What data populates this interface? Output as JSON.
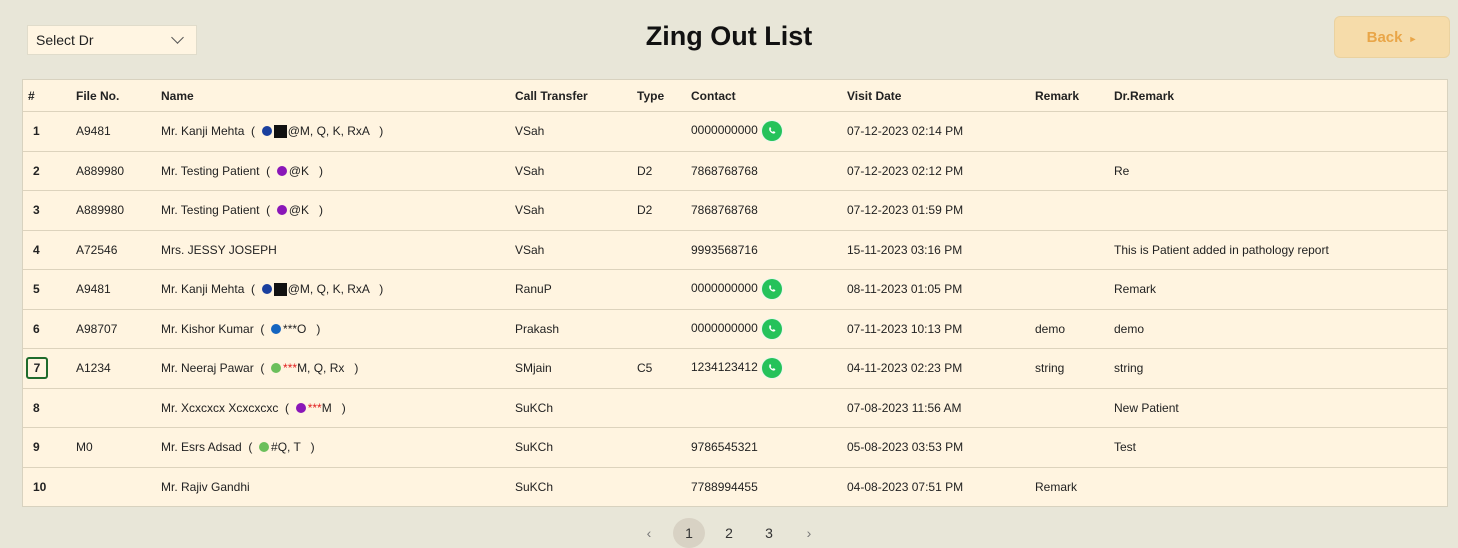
{
  "doctor_select": {
    "value": "Select Dr"
  },
  "title": "Zing Out List",
  "back": {
    "label": "Back",
    "arrow": "►"
  },
  "columns": [
    "#",
    "File No.",
    "Name",
    "Call Transfer",
    "Type",
    "Contact",
    "Visit Date",
    "Remark",
    "Dr.Remark"
  ],
  "rows": [
    {
      "num": "1",
      "file": "A9481",
      "name": "Mr. Kanji Mehta",
      "tag_prefix": "",
      "tag": "@M, Q, K, RxA",
      "dot_color": "#1a3f9e",
      "square": true,
      "transfer": "VSah",
      "type": "",
      "contact": "0000000000",
      "whatsapp": true,
      "date": "07-12-2023 02:14 PM",
      "remark": "",
      "dr_remark": ""
    },
    {
      "num": "2",
      "file": "A889980",
      "name": "Mr. Testing Patient",
      "tag_prefix": "",
      "tag": "@K",
      "dot_color": "#8a16b8",
      "square": false,
      "transfer": "VSah",
      "type": "D2",
      "contact": "7868768768",
      "whatsapp": false,
      "date": "07-12-2023 02:12 PM",
      "remark": "",
      "dr_remark": "Re"
    },
    {
      "num": "3",
      "file": "A889980",
      "name": "Mr. Testing Patient",
      "tag_prefix": "",
      "tag": "@K",
      "dot_color": "#8a16b8",
      "square": false,
      "transfer": "VSah",
      "type": "D2",
      "contact": "7868768768",
      "whatsapp": false,
      "date": "07-12-2023 01:59 PM",
      "remark": "",
      "dr_remark": ""
    },
    {
      "num": "4",
      "file": "A72546",
      "name": "Mrs. JESSY JOSEPH",
      "tag_prefix": "",
      "tag": "",
      "dot_color": "",
      "square": false,
      "transfer": "VSah",
      "type": "",
      "contact": "9993568716",
      "whatsapp": false,
      "date": "15-11-2023 03:16 PM",
      "remark": "",
      "dr_remark": "This is Patient added in pathology report"
    },
    {
      "num": "5",
      "file": "A9481",
      "name": "Mr. Kanji Mehta",
      "tag_prefix": "",
      "tag": "@M, Q, K, RxA",
      "dot_color": "#1a3f9e",
      "square": true,
      "transfer": "RanuP",
      "type": "",
      "contact": "0000000000",
      "whatsapp": true,
      "date": "08-11-2023 01:05 PM",
      "remark": "",
      "dr_remark": "Remark"
    },
    {
      "num": "6",
      "file": "A98707",
      "name": "Mr. Kishor Kumar",
      "tag_prefix": "",
      "tag": "***O",
      "dot_color": "#1565c0",
      "square": false,
      "transfer": "Prakash",
      "type": "",
      "contact": "0000000000",
      "whatsapp": true,
      "date": "07-11-2023 10:13 PM",
      "remark": "demo",
      "dr_remark": "demo"
    },
    {
      "num": "7",
      "file": "A1234",
      "name": "Mr. Neeraj Pawar",
      "tag_prefix": "***",
      "tag": "M, Q, Rx",
      "dot_color": "#6bbf5b",
      "square": false,
      "transfer": "SMjain",
      "type": "C5",
      "contact": "1234123412",
      "whatsapp": true,
      "date": "04-11-2023 02:23 PM",
      "remark": "string",
      "dr_remark": "string"
    },
    {
      "num": "8",
      "file": "",
      "name": "Mr. Xcxcxcx Xcxcxcxc",
      "tag_prefix": "***",
      "tag": "M",
      "dot_color": "#8a16b8",
      "square": false,
      "transfer": "SuKCh",
      "type": "",
      "contact": "",
      "whatsapp": false,
      "date": "07-08-2023 11:56 AM",
      "remark": "",
      "dr_remark": "New Patient"
    },
    {
      "num": "9",
      "file": "M0",
      "name": "Mr. Esrs Adsad",
      "tag_prefix": "",
      "tag": "#Q, T",
      "dot_color": "#6bbf5b",
      "square": false,
      "transfer": "SuKCh",
      "type": "",
      "contact": "9786545321",
      "whatsapp": false,
      "date": "05-08-2023 03:53 PM",
      "remark": "",
      "dr_remark": "Test"
    },
    {
      "num": "10",
      "file": "",
      "name": "Mr. Rajiv Gandhi",
      "tag_prefix": "",
      "tag": "",
      "dot_color": "",
      "square": false,
      "transfer": "SuKCh",
      "type": "",
      "contact": "7788994455",
      "whatsapp": false,
      "date": "04-08-2023 07:51 PM",
      "remark": "Remark",
      "dr_remark": ""
    }
  ],
  "pagination": {
    "prev": "‹",
    "pages": [
      "1",
      "2",
      "3"
    ],
    "next": "›",
    "current": "1"
  },
  "colors": {
    "accent": "#e9a648",
    "whatsapp": "#25c25a",
    "background": "#e8e6d8",
    "table_bg": "#fff4e0"
  }
}
